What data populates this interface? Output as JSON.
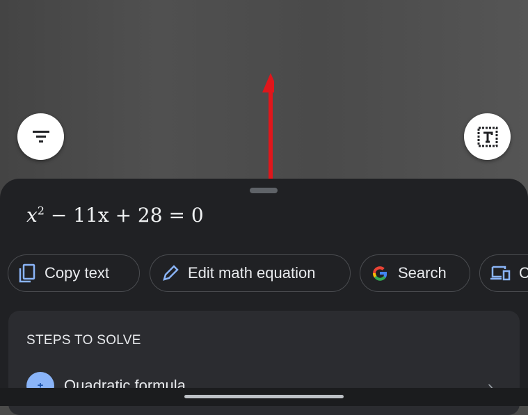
{
  "camera": {
    "filter_icon": "filter-icon",
    "text_select_icon": "text-select-icon",
    "annotation_arrow_color": "#e0161b"
  },
  "sheet": {
    "equation_base": "x",
    "equation_exp": "2",
    "equation_rest": " − 11x + 28 = 0",
    "chips": [
      {
        "label": "Copy text",
        "icon": "copy-icon"
      },
      {
        "label": "Edit math equation",
        "icon": "pencil-icon"
      },
      {
        "label": "Search",
        "icon": "google-icon"
      },
      {
        "label": "C",
        "icon": "devices-icon"
      }
    ],
    "steps_card": {
      "title": "STEPS TO SOLVE",
      "items": [
        {
          "label": "Quadratic formula",
          "icon": "plus-minus-icon",
          "icon_text": "±"
        }
      ]
    }
  },
  "colors": {
    "sheet": "#202124",
    "accent": "#8ab4f8"
  }
}
